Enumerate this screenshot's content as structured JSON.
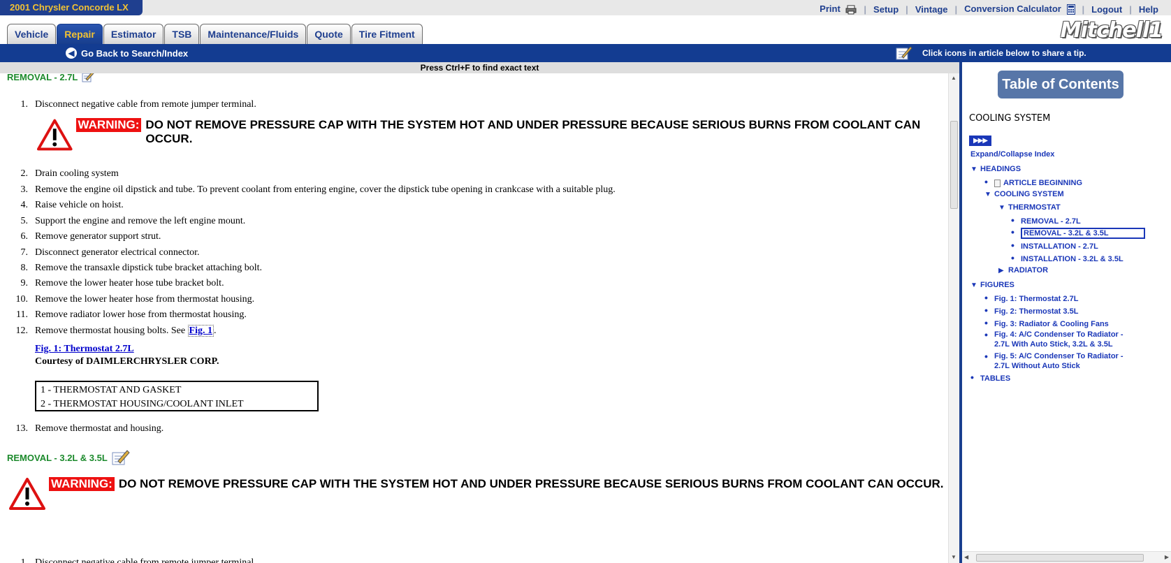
{
  "header": {
    "vehicle_title": "2001 Chrysler Concorde LX",
    "links": [
      "Print",
      "Setup",
      "Vintage",
      "Conversion Calculator",
      "Logout",
      "Help"
    ]
  },
  "tabs": [
    "Vehicle",
    "Repair",
    "Estimator",
    "TSB",
    "Maintenance/Fluids",
    "Quote",
    "Tire Fitment"
  ],
  "active_tab": "Repair",
  "logo_text": "Mitchell1",
  "nav": {
    "back_label": "Go Back to Search/Index",
    "tip_text": "Click icons in article below to share a tip."
  },
  "find_hint": "Press Ctrl+F to find exact text",
  "article": {
    "heading1": "REMOVAL - 2.7L",
    "step1": {
      "num": "1.",
      "text": "Disconnect negative cable from remote jumper terminal."
    },
    "warning_label": "WARNING:",
    "warning_text": "DO NOT REMOVE PRESSURE CAP WITH THE SYSTEM HOT AND UNDER PRESSURE BECAUSE SERIOUS BURNS FROM COOLANT CAN OCCUR.",
    "steps": [
      {
        "num": "2.",
        "text": "Drain cooling system"
      },
      {
        "num": "3.",
        "text": "Remove the engine oil dipstick and tube. To prevent coolant from entering engine, cover the dipstick tube opening in crankcase with a suitable plug."
      },
      {
        "num": "4.",
        "text": "Raise vehicle on hoist."
      },
      {
        "num": "5.",
        "text": "Support the engine and remove the left engine mount."
      },
      {
        "num": "6.",
        "text": "Remove generator support strut."
      },
      {
        "num": "7.",
        "text": "Disconnect generator electrical connector."
      },
      {
        "num": "8.",
        "text": "Remove the transaxle dipstick tube bracket attaching bolt."
      },
      {
        "num": "9.",
        "text": "Remove the lower heater hose tube bracket bolt."
      },
      {
        "num": "10.",
        "text": "Remove the lower heater hose from thermostat housing."
      },
      {
        "num": "11.",
        "text": "Remove radiator lower hose from thermostat housing."
      }
    ],
    "step12": {
      "num": "12.",
      "text": "Remove thermostat housing bolts. See ",
      "link": "Fig. 1",
      "end": "."
    },
    "figure_title": "Fig. 1: Thermostat 2.7L",
    "courtesy": "Courtesy of DAIMLERCHRYSLER CORP.",
    "legend": [
      "1 - THERMOSTAT AND GASKET",
      "2 - THERMOSTAT HOUSING/COOLANT INLET"
    ],
    "step13": {
      "num": "13.",
      "text": "Remove thermostat and housing."
    },
    "heading2": "REMOVAL - 3.2L & 3.5L",
    "step_partial": {
      "num": "1.",
      "text": "Disconnect negative cable from remote jumper terminal."
    }
  },
  "toc": {
    "title": "Table of Contents",
    "section": "COOLING SYSTEM",
    "expand_label": "Expand/Collapse Index",
    "items": {
      "headings": "HEADINGS",
      "article_beginning": "ARTICLE BEGINNING",
      "cooling_system": "COOLING SYSTEM",
      "thermostat": "THERMOSTAT",
      "removal_27": "REMOVAL - 2.7L",
      "removal_32": "REMOVAL - 3.2L & 3.5L",
      "installation_27": "INSTALLATION - 2.7L",
      "installation_32": "INSTALLATION - 3.2L & 3.5L",
      "radiator": "RADIATOR",
      "figures": "FIGURES",
      "fig1": "Fig. 1: Thermostat 2.7L",
      "fig2": "Fig. 2: Thermostat 3.5L",
      "fig3": "Fig. 3: Radiator & Cooling Fans",
      "fig4": "Fig. 4: A/C Condenser To Radiator - 2.7L With Auto Stick, 3.2L & 3.5L",
      "fig5": "Fig. 5: A/C Condenser To Radiator - 2.7L Without Auto Stick",
      "tables": "TABLES"
    }
  },
  "colors": {
    "brand_blue": "#133c91",
    "active_tab_text": "#f2c233",
    "heading_green": "#1c8a2c",
    "warning_red": "#ee1111",
    "link_blue": "#1a37b8"
  }
}
